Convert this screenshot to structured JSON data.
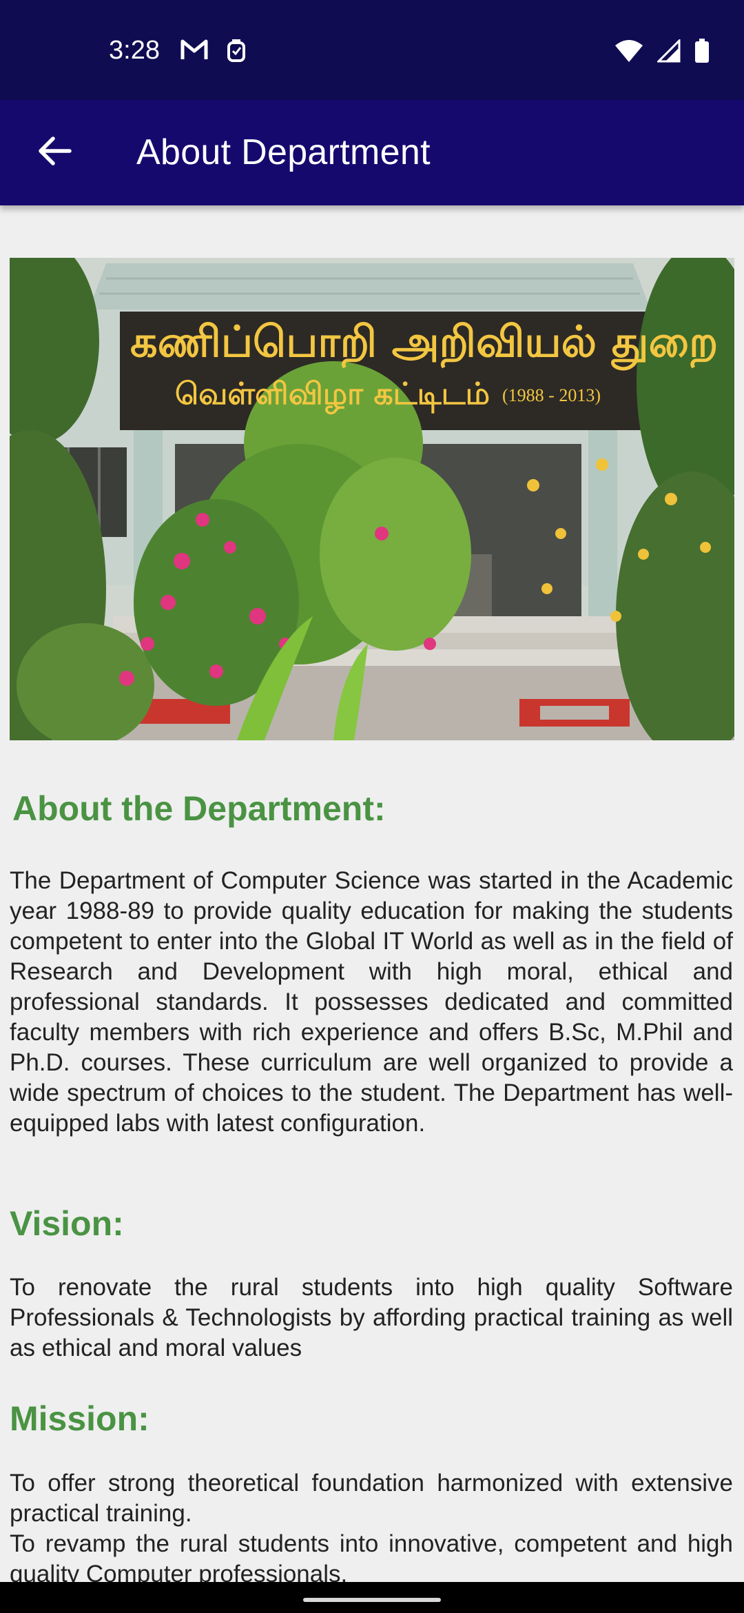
{
  "status_bar": {
    "time": "3:28",
    "left_icons": [
      "gmail-icon",
      "notification-icon"
    ],
    "right_icons": [
      "wifi-icon",
      "signal-icon",
      "battery-icon"
    ]
  },
  "app_bar": {
    "title": "About Department",
    "back_icon": "arrow-left-icon"
  },
  "hero_image": {
    "sign_line_1": "கணிப்பொறி அறிவியல் துறை",
    "sign_line_2": "வெள்ளிவிழா கட்டிடம்",
    "sign_years": "(1988 - 2013)"
  },
  "sections": {
    "about": {
      "heading": "About the Department:",
      "body": "The Department of Computer Science was started in the Academic year 1988-89 to provide quality education for making the students competent to enter into the Global IT World as well as in the field of Research and Development with high moral, ethical and professional standards. It possesses dedicated and committed faculty members with rich experience and offers B.Sc, M.Phil and Ph.D. courses. These curriculum are well organized to provide a wide spectrum of choices to the student. The Department has well-equipped labs with latest configuration."
    },
    "vision": {
      "heading": "Vision:",
      "body": "To renovate the rural students into high quality Software Professionals & Technologists by affording practical training as well as ethical and moral values"
    },
    "mission": {
      "heading": "Mission:",
      "line_1": "To offer strong theoretical foundation harmonized with extensive practical training.",
      "line_2": "To revamp the rural students into innovative, competent and high quality Computer professionals."
    }
  },
  "colors": {
    "status_bar": "#100c52",
    "app_bar": "#16096e",
    "heading_green": "#4a9343",
    "background": "#efefef"
  }
}
